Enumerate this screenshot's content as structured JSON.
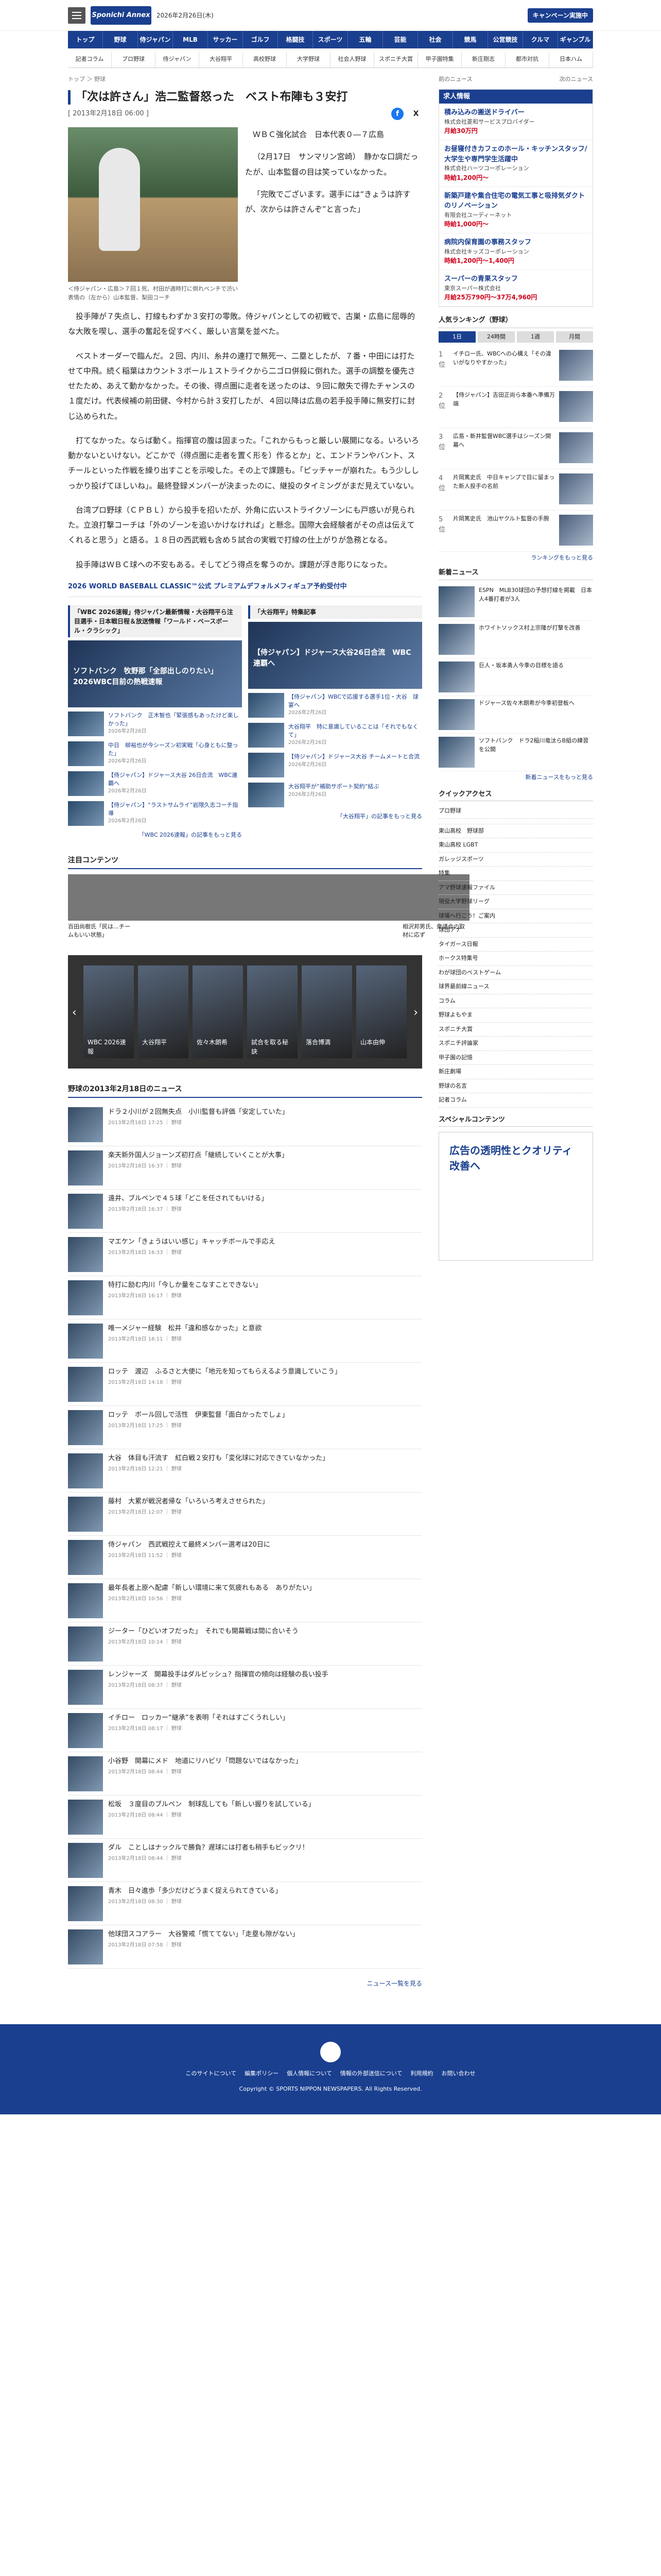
{
  "header": {
    "logo": "Sponichi Annex",
    "date": "2026年2月26日(木)",
    "cta": "キャンペーン実施中"
  },
  "nav1": [
    "トップ",
    "野球",
    "侍ジャパン",
    "MLB",
    "サッカー",
    "ゴルフ",
    "格闘技",
    "スポーツ",
    "五輪",
    "芸能",
    "社会",
    "競馬",
    "公営競技",
    "クルマ",
    "ギャンブル"
  ],
  "nav2": [
    "記者コラム",
    "プロ野球",
    "侍ジャパン",
    "大谷翔平",
    "高校野球",
    "大学野球",
    "社会人野球",
    "スポニチ大賞",
    "甲子園特集",
    "新庄剛志",
    "都市対抗",
    "日本ハム"
  ],
  "article": {
    "crumb": "トップ ＞ 野球",
    "title": "「次は許さん」浩二監督怒った　ベスト布陣も３安打",
    "date": "[ 2013年2月18日 06:00 ]",
    "caption": "＜侍ジャパン・広島＞７回１死、村田が適時打に倒れベンチで渋い表情の（左から）山本監督、梨田コーチ",
    "lede": [
      "ＷＢＣ強化試合　日本代表０―７広島",
      "（2月17日　サンマリン宮崎）　静かな口調だったが、山本監督の目は笑っていなかった。",
      "「完敗でございます。選手には“きょうは許すが、次からは許さんぞ”と言った」"
    ],
    "body": [
      "投手陣が７失点し、打線もわずか３安打の零敗。侍ジャパンとしての初戦で、古巣・広島に屈辱的な大敗を喫し、選手の奮起を促すべく、厳しい言葉を並べた。",
      "ベストオーダーで臨んだ。２回、内川、糸井の連打で無死一、二塁としたが、７番・中田には打たせて中飛。続く稲葉はカウント３ボール１ストライクから二ゴロ併殺に倒れた。選手の調整を優先させたため、あえて動かなかった。その後、得点圏に走者を送ったのは、９回に敵失で得たチャンスの１度だけ。代表候補の前田健、今村から計３安打したが、４回以降は広島の若手投手陣に無安打に封じ込められた。",
      "打てなかった。ならば動く。指揮官の腹は固まった。「これからもっと厳しい展開になる。いろいろ動かないといけない。どこかで（得点圏に走者を置く形を）作るとか」と、エンドランやバント、スチールといった作戦を繰り出すことを示唆した。その上で課題も。「ピッチャーが崩れた。もう少ししっかり投げてほしいね」。最終登録メンバーが決まったのに、継投のタイミングがまだ見えていない。",
      "台湾プロ野球（ＣＰＢＬ）から投手を招いたが、外角に広いストライクゾーンにも戸惑いが見られた。立浪打撃コーチは「外のゾーンを追いかけなければ」と懸念。国際大会経験者がその点は伝えてくれると思う」と語る。１８日の西武戦も含め５試合の実戦で打線の仕上がりが急務となる。",
      "投手陣はＷＢＣ球への不安もある。そしてどう得点を奪うのか。課題が浮き彫りになった。"
    ],
    "promo": "2026 WORLD BASEBALL CLASSIC™公式 プレミアムデフォルメフィギュア予約受付中"
  },
  "pickups": [
    {
      "head": "「WBC 2026速報」侍ジャパン最新情報・大谷翔平ら注目選手・日本戦日程＆放送情報「ワールド・ベースボール・クラシック」",
      "big": "ソフトバンク　牧野那「全部出しのりたい」2026WBC目前の熱戦速報",
      "items": [
        {
          "t": "ソフトバンク　正木智也「緊張感もあったけど楽しかった」",
          "d": "2026年2月26日"
        },
        {
          "t": "中日　柳裕也が今シーズン初実戦「心身ともに整った」",
          "d": "2026年2月26日"
        },
        {
          "t": "【侍ジャパン】ドジャース大谷 26日合流　WBC連覇へ",
          "d": "2026年2月26日"
        },
        {
          "t": "【侍ジャパン】“ラストサムライ”岩隈久志コーチ指導",
          "d": "2026年2月26日"
        }
      ],
      "more": "「WBC 2026速報」の記事をもっと見る"
    },
    {
      "head": "「大谷翔平」特集記事",
      "big": "【侍ジャパン】ドジャース大谷26日合流　WBC連覇へ",
      "items": [
        {
          "t": "【侍ジャパン】WBCで応援する選手1位・大谷　球宴へ",
          "d": "2026年2月26日"
        },
        {
          "t": "大谷翔平　特に意識していることは「それでもなくて」",
          "d": "2026年2月26日"
        },
        {
          "t": "【侍ジャパン】ドジャース大谷 チームメートと合流",
          "d": "2026年2月26日"
        },
        {
          "t": "大谷翔平が“補助サポート契約”結ぶ",
          "d": "2026年2月26日"
        }
      ],
      "more": "「大谷翔平」の記事をもっと見る"
    }
  ],
  "chumoku": {
    "title": "注目コンテンツ",
    "items": [
      "百田尚樹氏「民は…チームもいい状態」",
      "",
      "",
      "",
      "",
      "相沢邦男氏、衆議会の取材に応ず"
    ]
  },
  "carousel": [
    "WBC 2026速報",
    "大谷翔平",
    "佐々木朗希",
    "試合を取る秘訣",
    "落合博満",
    "山本由伸"
  ],
  "news": {
    "title": "野球の2013年2月18日のニュース",
    "items": [
      {
        "t": "ドラ２小川が２回無失点　小川監督も評価「安定していた」",
        "d": "2013年2月18日 17:25 ｜ 野球"
      },
      {
        "t": "楽天新外国人ジョーンズ初打点「継続していくことが大事」",
        "d": "2013年2月18日 16:37 ｜ 野球"
      },
      {
        "t": "遠井、ブルペンで４５球「どこを任されてもいける」",
        "d": "2013年2月18日 16:37 ｜ 野球"
      },
      {
        "t": "マエケン「きょうはいい感じ」キャッチボールで手応え",
        "d": "2013年2月18日 16:33 ｜ 野球"
      },
      {
        "t": "特打に励む内川「今しか量をこなすことできない」",
        "d": "2013年2月18日 16:17 ｜ 野球"
      },
      {
        "t": "唯一メジャー経験　松井「違和感なかった」と意欲",
        "d": "2013年2月18日 16:11 ｜ 野球"
      },
      {
        "t": "ロッテ　渡辺　ふるさと大使に「地元を知ってもらえるよう意識していこう」",
        "d": "2013年2月18日 14:18 ｜ 野球"
      },
      {
        "t": "ロッテ　ボール回しで活性　伊東監督「面白かったでしょ」",
        "d": "2013年2月18日 17:25 ｜ 野球"
      },
      {
        "t": "大谷　体目も汗流す　紅白戦２安打も「変化球に対応できていなかった」",
        "d": "2013年2月18日 12:21 ｜ 野球"
      },
      {
        "t": "藤村　大累が戦況者帰な「いろいろ考えさせられた」",
        "d": "2013年2月18日 12:07 ｜ 野球"
      },
      {
        "t": "侍ジャパン　西武戦控えて最終メンバー選考は20日に",
        "d": "2013年2月18日 11:52 ｜ 野球"
      },
      {
        "t": "最年長者上原へ配慮「新しい環境に来て気疲れもある　ありがたい」",
        "d": "2013年2月18日 10:56 ｜ 野球"
      },
      {
        "t": "ジーター「ひどいオフだった」　それでも開幕戦は間に合いそう",
        "d": "2013年2月18日 10:14 ｜ 野球"
      },
      {
        "t": "レンジャーズ　開幕投手はダルビッシュ？指揮官の傾向は経験の長い投手",
        "d": "2013年2月18日 08:37 ｜ 野球"
      },
      {
        "t": "イチロー　ロッカー“継承”を表明「それはすごくうれしい」",
        "d": "2013年2月18日 08:17 ｜ 野球"
      },
      {
        "t": "小谷野　開幕にメド　地道にリハビリ「問題ないではなかった」",
        "d": "2013年2月18日 08:44 ｜ 野球"
      },
      {
        "t": "松坂　３度目のブルペン　制球乱しても「新しい握りを試している」",
        "d": "2013年2月18日 08:44 ｜ 野球"
      },
      {
        "t": "ダル　ことしはナックルで勝負？遅球には打者も稍手もビックリ！",
        "d": "2013年2月18日 08:44 ｜ 野球"
      },
      {
        "t": "青木　日々進歩「多少だけどうまく捉えられてきている」",
        "d": "2013年2月18日 08:30 ｜ 野球"
      },
      {
        "t": "他球団スコアラー　大谷警戒「慌ててない」「走塁も隙がない」",
        "d": "2013年2月18日 07:58 ｜ 野球"
      }
    ],
    "more": "ニュース一覧を見る"
  },
  "side": {
    "prev": "前のニュース",
    "next": "次のニュース",
    "jobs_title": "求人情報",
    "jobs": [
      {
        "t": "積み込みの搬送ドライバー",
        "c": "株式会社菱和サービスプロバイダー",
        "p": "月給30万円"
      },
      {
        "t": "お昼寝付きカフェのホール・キッチンスタッフ/大学生や専門学生活躍中",
        "c": "株式会社ハーツコーポレーション",
        "p": "時給1,200円〜"
      },
      {
        "t": "新築戸建や集合住宅の電気工事と吸排気ダクトのリノベーション",
        "c": "有限会社ユーディーネット",
        "p": "時給1,000円〜"
      },
      {
        "t": "病院内保育園の事務スタッフ",
        "c": "株式会社キッズコーポレーション",
        "p": "時給1,200円〜1,400円"
      },
      {
        "t": "スーパーの青果スタッフ",
        "c": "東京スーパー株式会社",
        "p": "月給25万790円〜37万4,960円"
      }
    ],
    "ranking_title": "人気ランキング（野球）",
    "tabs": [
      "1日",
      "24時間",
      "1週",
      "月間"
    ],
    "ranks": [
      "イチロー氏、WBCへの心構え「その違いがなりやすかった」",
      "【侍ジャパン】吉田正尚ら本番へ準備万端",
      "広島・新井監督WBC選手はシーズン開幕へ",
      "片岡篤史氏　中日キャンプで目に留まった新人投手の名前",
      "片岡篤史氏　池山ヤクルト監督の手腕"
    ],
    "rank_more": "ランキングをもっと見る",
    "new_title": "新着ニュース",
    "newitems": [
      "ESPN　MLB30球団の予想打線を掲載　日本人4番打者が3人",
      "ホワイトソックス村上宗隆が打撃を改善",
      "巨人・坂本勇人今季の目標を語る",
      "ドジャース佐々木朗希が今季初登板へ",
      "ソフトバンク　ドラ2稲川竜汰らB組の練習を公開"
    ],
    "new_more": "新着ニュースをもっと見る",
    "qa_title": "クイックアクセス",
    "qa": [
      "プロ野球",
      "",
      "東山高校　野球部",
      "東山高校 LGBT",
      "ガレッジスポーツ",
      "特集",
      "アマ野球速報ファイル",
      "現役大学野球リーグ",
      "球場へ行こう！ご案内",
      "球団アナ",
      "タイガース日報",
      "ホークス特集号",
      "わが球団のベストゲーム",
      "球界最前線ニュース",
      "コラム",
      "野球よもやま",
      "スポニチ大賞",
      "スポニチ評論家",
      "甲子園の記憶",
      "新庄劇場",
      "野球の名言",
      "記者コラム"
    ],
    "special_title": "スペシャルコンテンツ",
    "ad": "広告の透明性とクオリティ改善へ"
  },
  "footer": {
    "links": [
      "このサイトについて",
      "編集ポリシー",
      "個人情報について",
      "情報の外部送信について",
      "利用規約",
      "お問い合わせ"
    ],
    "copyright": "Copyright © SPORTS NIPPON NEWSPAPERS. All Rights Reserved."
  }
}
